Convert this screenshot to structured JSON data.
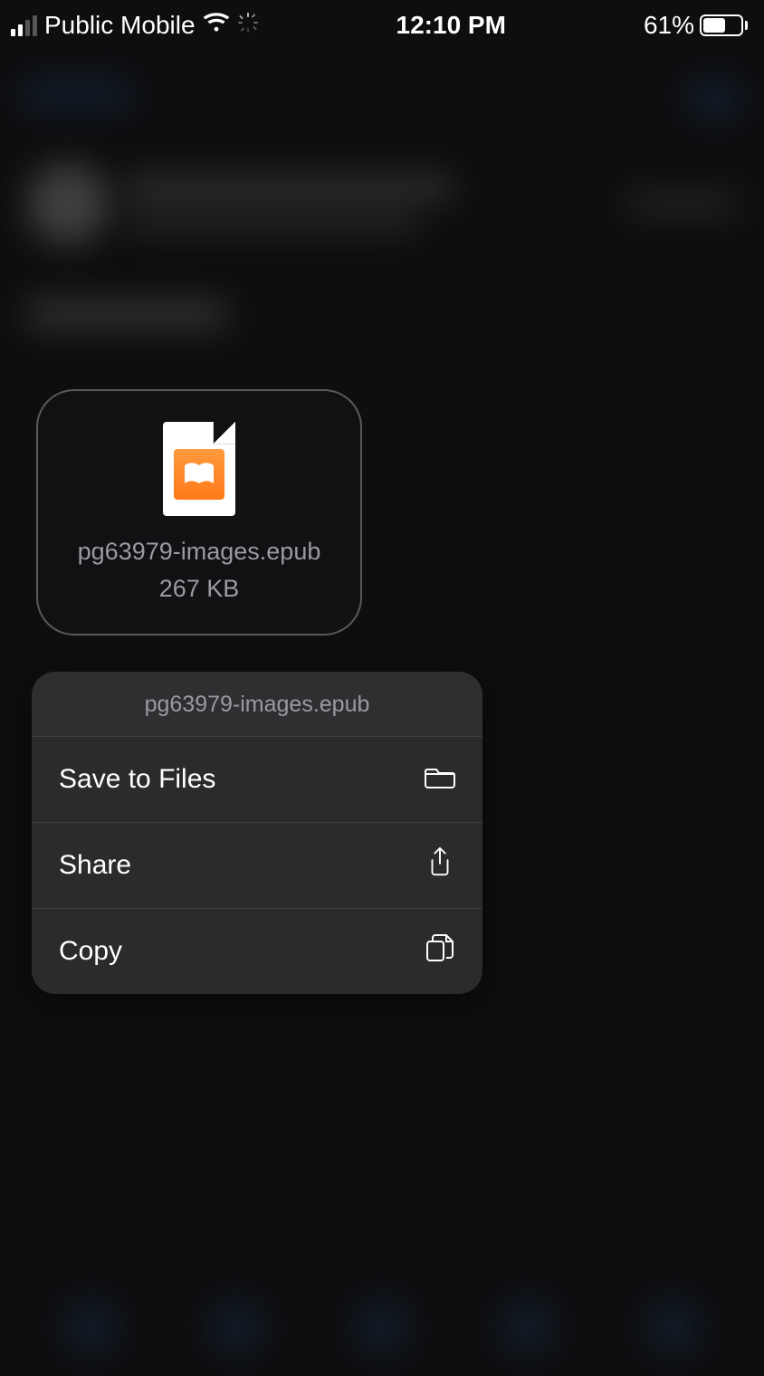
{
  "statusbar": {
    "carrier": "Public Mobile",
    "time": "12:10 PM",
    "battery_pct": "61%"
  },
  "file": {
    "name": "pg63979-images.epub",
    "size": "267 KB"
  },
  "context_menu": {
    "header": "pg63979-images.epub",
    "items": {
      "save": "Save to Files",
      "share": "Share",
      "copy": "Copy"
    }
  }
}
